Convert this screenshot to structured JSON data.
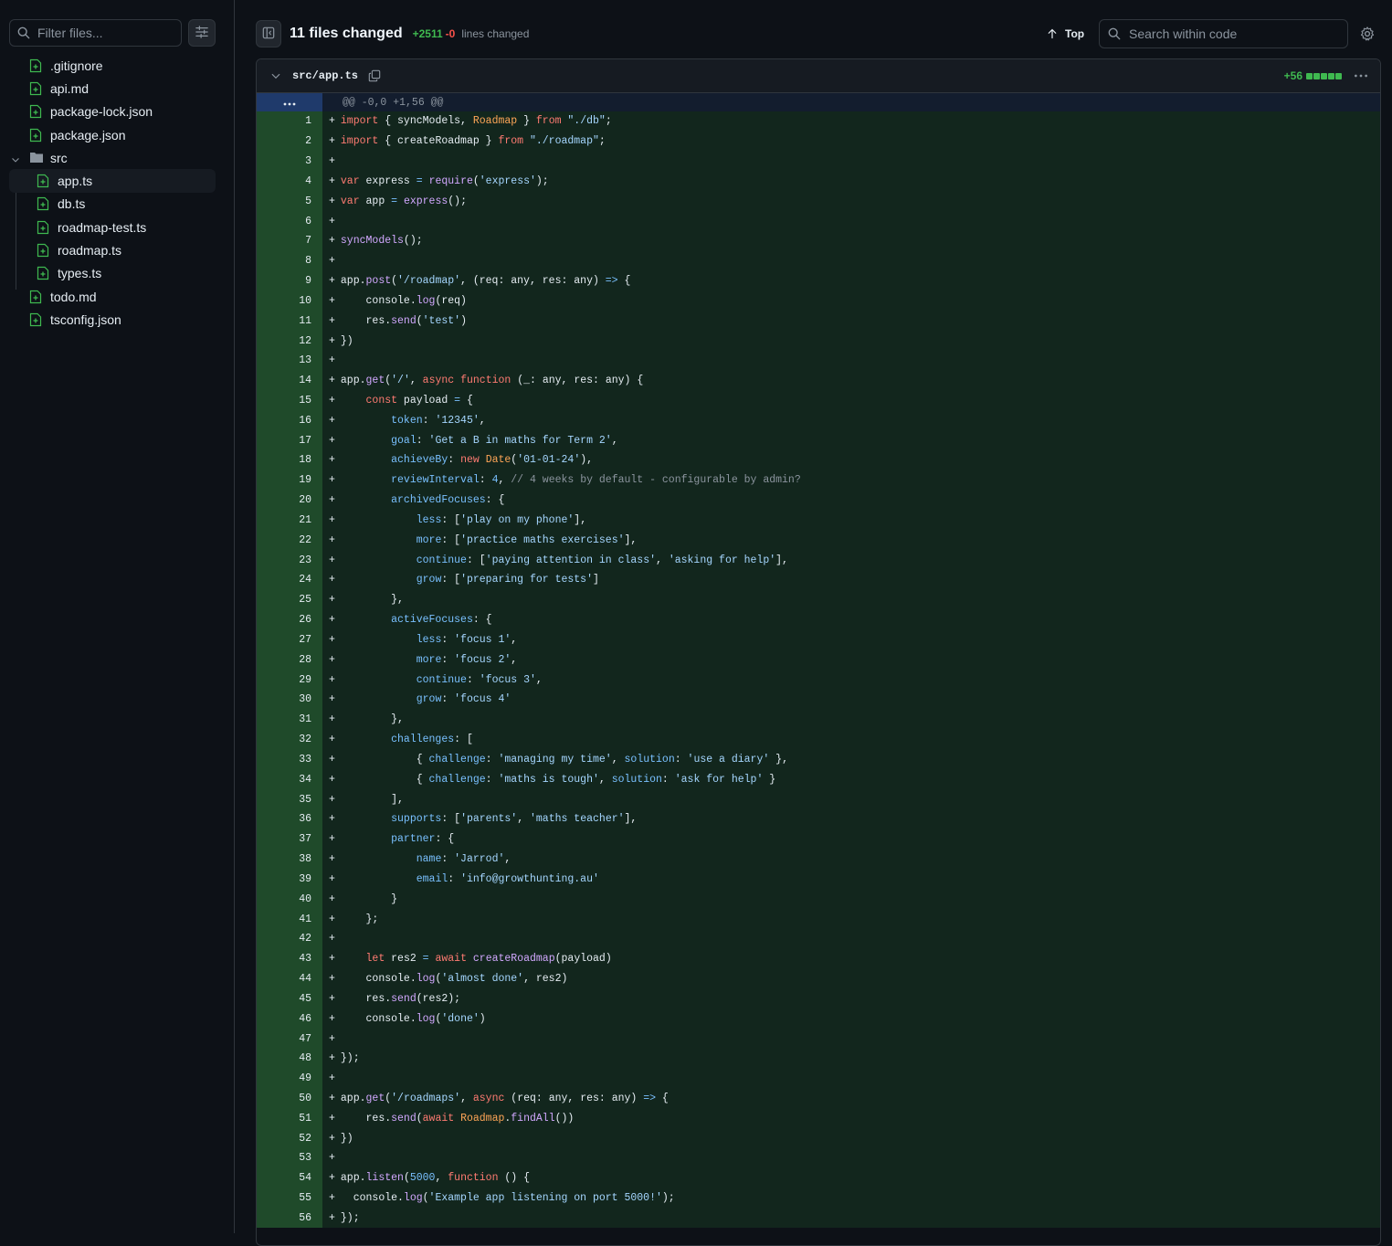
{
  "sidebar": {
    "filter_placeholder": "Filter files...",
    "tree": [
      {
        "name": ".gitignore",
        "type": "file",
        "depth": 0
      },
      {
        "name": "api.md",
        "type": "file",
        "depth": 0
      },
      {
        "name": "package-lock.json",
        "type": "file",
        "depth": 0
      },
      {
        "name": "package.json",
        "type": "file",
        "depth": 0
      },
      {
        "name": "src",
        "type": "folder",
        "depth": 0,
        "expanded": true
      },
      {
        "name": "app.ts",
        "type": "file",
        "depth": 1,
        "selected": true
      },
      {
        "name": "db.ts",
        "type": "file",
        "depth": 1
      },
      {
        "name": "roadmap-test.ts",
        "type": "file",
        "depth": 1
      },
      {
        "name": "roadmap.ts",
        "type": "file",
        "depth": 1
      },
      {
        "name": "types.ts",
        "type": "file",
        "depth": 1
      },
      {
        "name": "todo.md",
        "type": "file",
        "depth": 0
      },
      {
        "name": "tsconfig.json",
        "type": "file",
        "depth": 0
      }
    ]
  },
  "header": {
    "files_changed": "11 files changed",
    "additions": "+2511",
    "deletions": "-0",
    "lines_changed_label": "lines changed",
    "top_label": "Top",
    "search_placeholder": "Search within code"
  },
  "file": {
    "path": "src/app.ts",
    "additions": "+56",
    "hunk_header": "@@ -0,0 +1,56 @@",
    "lines": [
      "import { syncModels, Roadmap } from \"./db\";",
      "import { createRoadmap } from \"./roadmap\";",
      "",
      "var express = require('express');",
      "var app = express();",
      "",
      "syncModels();",
      "",
      "app.post('/roadmap', (req: any, res: any) => {",
      "    console.log(req)",
      "    res.send('test')",
      "})",
      "",
      "app.get('/', async function (_: any, res: any) {",
      "    const payload = {",
      "        token: '12345',",
      "        goal: 'Get a B in maths for Term 2',",
      "        achieveBy: new Date('01-01-24'),",
      "        reviewInterval: 4, // 4 weeks by default - configurable by admin?",
      "        archivedFocuses: {",
      "            less: ['play on my phone'],",
      "            more: ['practice maths exercises'],",
      "            continue: ['paying attention in class', 'asking for help'],",
      "            grow: ['preparing for tests']",
      "        },",
      "        activeFocuses: {",
      "            less: 'focus 1',",
      "            more: 'focus 2',",
      "            continue: 'focus 3',",
      "            grow: 'focus 4'",
      "        },",
      "        challenges: [",
      "            { challenge: 'managing my time', solution: 'use a diary' },",
      "            { challenge: 'maths is tough', solution: 'ask for help' }",
      "        ],",
      "        supports: ['parents', 'maths teacher'],",
      "        partner: {",
      "            name: 'Jarrod',",
      "            email: 'info@growthunting.au'",
      "        }",
      "    };",
      "",
      "    let res2 = await createRoadmap(payload)",
      "    console.log('almost done', res2)",
      "    res.send(res2);",
      "    console.log('done')",
      "",
      "});",
      "",
      "app.get('/roadmaps', async (req: any, res: any) => {",
      "    res.send(await Roadmap.findAll())",
      "})",
      "",
      "app.listen(5000, function () {",
      "  console.log('Example app listening on port 5000!');",
      "});"
    ]
  },
  "colors": {
    "background": "#0d1117",
    "added_line_bg": "#12261d",
    "added_gutter_bg": "#1f4a2a",
    "additions": "#3fb950",
    "deletions": "#f85149"
  }
}
